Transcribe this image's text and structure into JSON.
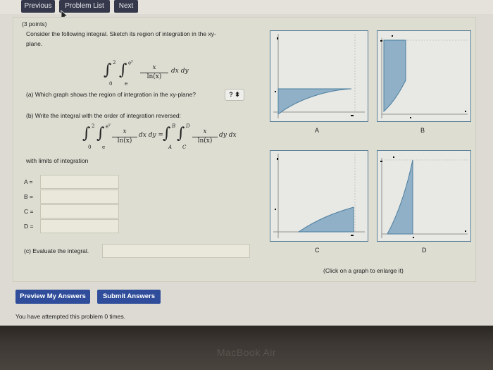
{
  "nav": {
    "previous": "Previous",
    "problem_list": "Problem List",
    "next": "Next"
  },
  "problem": {
    "points": "(3 points)",
    "statement_line1": "Consider the following integral. Sketch its region of integration in the xy-",
    "statement_line2": "plane.",
    "integral": {
      "outer_lower": "0",
      "outer_upper": "2",
      "inner_lower": "e",
      "inner_upper": "e",
      "inner_upper_exp": "y",
      "numerator": "x",
      "denominator": "ln(x)",
      "differential": "dx dy"
    },
    "part_a": "(a) Which graph shows the region of integration in the xy-plane?",
    "part_a_select": "?",
    "part_b": "(b) Write the integral with the order of integration reversed:",
    "reversed": {
      "left_outer_lower": "0",
      "left_outer_upper": "2",
      "left_inner_lower": "e",
      "left_inner_upper": "e",
      "left_inner_upper_exp": "y",
      "left_diff": "dx dy =",
      "right_outer_lower": "A",
      "right_outer_upper": "B",
      "right_inner_lower": "C",
      "right_inner_upper": "D",
      "numerator": "x",
      "denominator": "ln(x)",
      "right_diff": "dy dx"
    },
    "limits_label": "with limits of integration",
    "limits": [
      {
        "label": "A =",
        "value": ""
      },
      {
        "label": "B =",
        "value": ""
      },
      {
        "label": "C =",
        "value": ""
      },
      {
        "label": "D =",
        "value": ""
      }
    ],
    "part_c": "(c) Evaluate the integral.",
    "part_c_value": ""
  },
  "graphs": {
    "labels": [
      "A",
      "B",
      "C",
      "D"
    ],
    "hint": "(Click on a graph to enlarge it)",
    "fill_color": "#8fb0c6",
    "stroke_color": "#4d7fa0"
  },
  "actions": {
    "preview": "Preview My Answers",
    "submit": "Submit Answers"
  },
  "status": "You have attempted this problem 0 times.",
  "device_label": "MacBook Air"
}
